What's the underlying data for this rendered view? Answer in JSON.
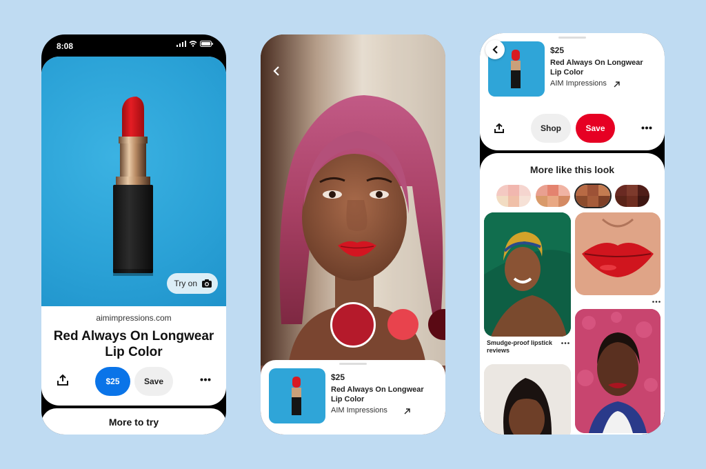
{
  "phone1": {
    "status_time": "8:08",
    "try_on_label": "Try on",
    "domain": "aimimpressions.com",
    "title": "Red Always On Longwear Lip Color",
    "price_button": "$25",
    "save_button": "Save",
    "more_to_try": "More to try"
  },
  "phone2": {
    "shade_colors": [
      "#b51a2b",
      "#e8434d",
      "#5a0a14"
    ],
    "product": {
      "price": "$25",
      "title": "Red Always On Longwear Lip Color",
      "brand": "AIM Impressions"
    }
  },
  "phone3": {
    "product": {
      "price": "$25",
      "title": "Red Always On Longwear Lip Color",
      "brand": "AIM Impressions"
    },
    "shop_button": "Shop",
    "save_button": "Save",
    "section_title": "More like this look",
    "pin_caption": "Smudge-proof lipstick reviews"
  },
  "colors": {
    "accent_red": "#e60023",
    "price_blue": "#0074e8",
    "background": "#bfdbf2"
  }
}
